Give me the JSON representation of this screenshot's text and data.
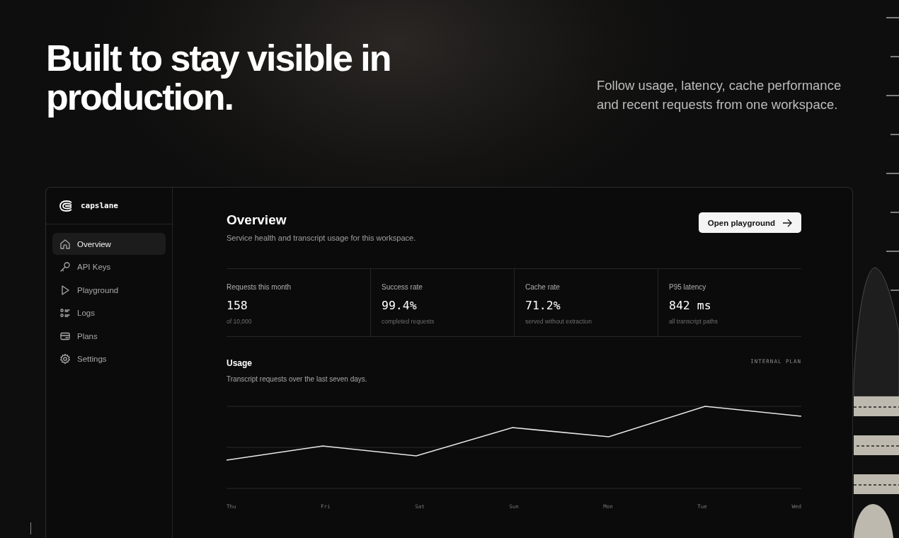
{
  "hero": {
    "title": "Built to stay visible in production.",
    "subtitle": "Follow usage, latency, cache performance and recent requests from one workspace."
  },
  "app": {
    "brand": "capslane",
    "nav": [
      {
        "label": "Overview",
        "selected": true
      },
      {
        "label": "API Keys",
        "selected": false
      },
      {
        "label": "Playground",
        "selected": false
      },
      {
        "label": "Logs",
        "selected": false
      },
      {
        "label": "Plans",
        "selected": false
      },
      {
        "label": "Settings",
        "selected": false
      }
    ],
    "header": {
      "title": "Overview",
      "subtitle": "Service health and transcript usage for this workspace.",
      "button": "Open playground"
    },
    "stats": [
      {
        "label": "Requests this month",
        "value": "158",
        "note": "of 10,000"
      },
      {
        "label": "Success rate",
        "value": "99.4%",
        "note": "completed requests"
      },
      {
        "label": "Cache rate",
        "value": "71.2%",
        "note": "served without extraction"
      },
      {
        "label": "P95 latency",
        "value": "842 ms",
        "note": "all transcript paths"
      }
    ],
    "usage": {
      "title": "Usage",
      "subtitle": "Transcript requests over the last seven days.",
      "plan": "INTERNAL PLAN",
      "days": [
        "Thu",
        "Fri",
        "Sat",
        "Sun",
        "Mon",
        "Tue",
        "Wed"
      ]
    }
  }
}
